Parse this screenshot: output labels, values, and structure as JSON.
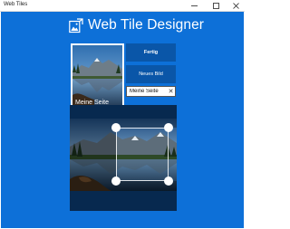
{
  "window": {
    "title": "Web Tiles"
  },
  "header": {
    "title": "Web Tile Designer",
    "logo_icon": "tile-designer-logo"
  },
  "preview": {
    "label": "Meine Seite"
  },
  "actions": {
    "done_label": "Fertig",
    "new_image_label": "Neues Bild"
  },
  "name_field": {
    "value": "Meine Seite",
    "clear_icon": "close-icon"
  },
  "colors": {
    "background": "#0d70d8",
    "button": "#0a56a8",
    "editor_bg": "#0a3a6e"
  }
}
